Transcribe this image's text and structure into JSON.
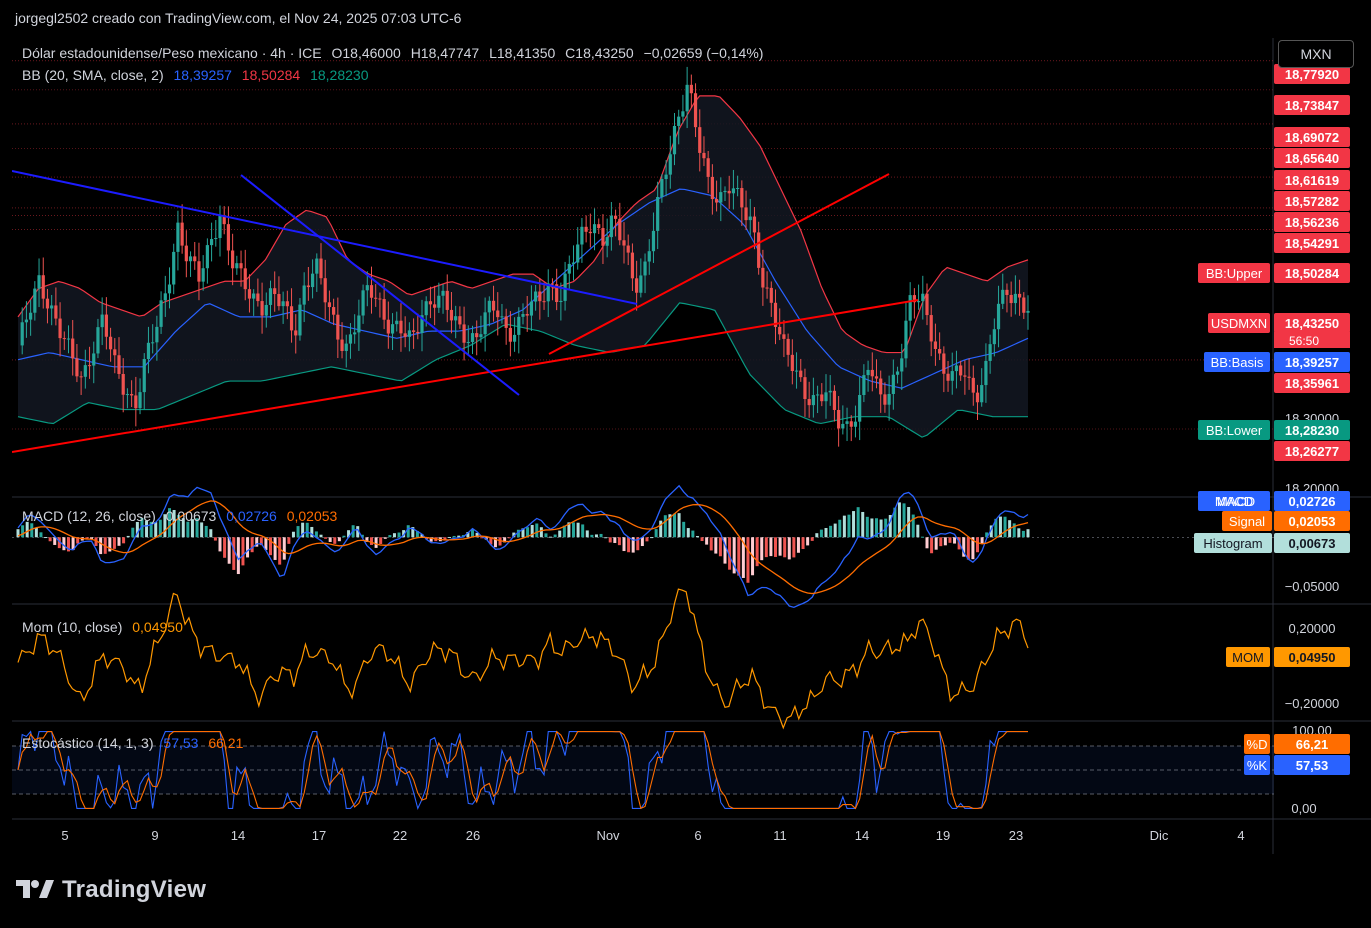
{
  "header": {
    "author_line": "jorgegl2502 creado con TradingView.com, el Nov 24, 2025 07:03 UTC-6"
  },
  "currency_button": "MXN",
  "main_legend": {
    "symbol": "Dólar estadounidense/Peso mexicano · 4h · ICE",
    "open": "O18,46000",
    "high": "H18,47747",
    "low": "L18,41350",
    "close": "C18,43250",
    "change": "−0,02659 (−0,14%)"
  },
  "bb_legend": {
    "label": "BB (20, SMA, close, 2)",
    "basis": "18,39257",
    "upper": "18,50284",
    "lower": "18,28230"
  },
  "macd_legend": {
    "label": "MACD (12, 26, close)",
    "hist": "0,00673",
    "macd": "0,02726",
    "signal": "0,02053"
  },
  "mom_legend": {
    "label": "Mom (10, close)",
    "value": "0,04950"
  },
  "stoch_legend": {
    "label": "Estocástico (14, 1, 3)",
    "k": "57,53",
    "d": "66,21"
  },
  "price_axis": {
    "red_labels": [
      "18,77920",
      "18,73847",
      "18,69072",
      "18,65640",
      "18,61619",
      "18,57282",
      "18,56236",
      "18,54291",
      "18,35961",
      "18,26277"
    ],
    "plain_labels": [
      "18,30000",
      "18,20000"
    ],
    "bb_upper": {
      "tag": "BB:Upper",
      "value": "18,50284"
    },
    "last_price": {
      "tag": "USDMXN",
      "value": "18,43250",
      "countdown": "56:50"
    },
    "bb_basis": {
      "tag": "BB:Basis",
      "value": "18,39257"
    },
    "bb_lower": {
      "tag": "BB:Lower",
      "value": "18,28230"
    }
  },
  "macd_axis": {
    "macd_tag": {
      "tag": "MACD",
      "value": "0,02726"
    },
    "signal_tag": {
      "tag": "Signal",
      "value": "0,02053"
    },
    "hist_tag": {
      "tag": "Histogram",
      "value": "0,00673"
    },
    "tick": "−0,05000"
  },
  "mom_axis": {
    "ticks": [
      "0,20000",
      "−0,20000"
    ],
    "tag": {
      "tag": "MOM",
      "value": "0,04950"
    }
  },
  "stoch_axis": {
    "ticks": [
      "100,00",
      "0,00"
    ],
    "d_tag": {
      "tag": "%D",
      "value": "66,21"
    },
    "k_tag": {
      "tag": "%K",
      "value": "57,53"
    }
  },
  "time_axis": [
    "5",
    "9",
    "14",
    "17",
    "22",
    "26",
    "Nov",
    "6",
    "11",
    "14",
    "19",
    "23",
    "Dic",
    "4"
  ],
  "brand": "TradingView",
  "colors": {
    "up": "#26a69a",
    "down": "#ef5350",
    "bb_upper": "#f23645",
    "bb_basis": "#2962ff",
    "bb_lower": "#089981",
    "macd": "#2962ff",
    "signal": "#ff6d00",
    "mom": "#ff9800",
    "trend_red": "#ff0000",
    "trend_blue": "#1c1cff"
  },
  "chart_data": {
    "type": "candlestick",
    "title": "Dólar estadounidense/Peso mexicano · 4h · ICE",
    "symbol": "USDMXN",
    "timeframe": "4h",
    "y_axis_price": [
      18.18,
      18.8
    ],
    "x_ticks": [
      "5",
      "9",
      "14",
      "17",
      "22",
      "26",
      "Nov",
      "6",
      "11",
      "14",
      "19",
      "23",
      "Dic",
      "4"
    ],
    "close_path": [
      18.38,
      18.42,
      18.47,
      18.44,
      18.4,
      18.36,
      18.33,
      18.38,
      18.42,
      18.35,
      18.32,
      18.3,
      18.36,
      18.4,
      18.46,
      18.55,
      18.5,
      18.47,
      18.52,
      18.57,
      18.5,
      18.47,
      18.45,
      18.44,
      18.45,
      18.43,
      18.4,
      18.47,
      18.49,
      18.44,
      18.4,
      18.38,
      18.42,
      18.46,
      18.44,
      18.41,
      18.4,
      18.38,
      18.43,
      18.45,
      18.44,
      18.41,
      18.4,
      18.39,
      18.42,
      18.43,
      18.4,
      18.41,
      18.43,
      18.44,
      18.47,
      18.45,
      18.49,
      18.53,
      18.56,
      18.53,
      18.55,
      18.52,
      18.47,
      18.49,
      18.56,
      18.63,
      18.7,
      18.75,
      18.66,
      18.6,
      18.59,
      18.61,
      18.57,
      18.55,
      18.48,
      18.43,
      18.37,
      18.35,
      18.32,
      18.3,
      18.31,
      18.28,
      18.27,
      18.29,
      18.35,
      18.31,
      18.32,
      18.36,
      18.44,
      18.45,
      18.4,
      18.34,
      18.33,
      18.35,
      18.31,
      18.34,
      18.42,
      18.46,
      18.45,
      18.43
    ],
    "bb_upper_path": [
      18.42,
      18.46,
      18.47,
      18.46,
      18.44,
      18.43,
      18.42,
      18.44,
      18.45,
      18.46,
      18.47,
      18.47,
      18.5,
      18.55,
      18.57,
      18.56,
      18.5,
      18.48,
      18.47,
      18.45,
      18.46,
      18.47,
      18.46,
      18.47,
      18.48,
      18.48,
      18.46,
      18.47,
      18.5,
      18.55,
      18.58,
      18.6,
      18.68,
      18.73,
      18.73,
      18.7,
      18.66,
      18.6,
      18.54,
      18.46,
      18.4,
      18.38,
      18.37,
      18.37,
      18.45,
      18.49,
      18.48,
      18.47,
      18.49,
      18.5
    ],
    "bb_basis_path": [
      18.36,
      18.37,
      18.36,
      18.35,
      18.35,
      18.4,
      18.44,
      18.42,
      18.42,
      18.43,
      18.41,
      18.4,
      18.39,
      18.4,
      18.4,
      18.41,
      18.43,
      18.47,
      18.51,
      18.55,
      18.58,
      18.6,
      18.59,
      18.55,
      18.47,
      18.4,
      18.35,
      18.33,
      18.32,
      18.34,
      18.36,
      18.37,
      18.39
    ],
    "bb_lower_path": [
      18.28,
      18.27,
      18.3,
      18.29,
      18.29,
      18.31,
      18.33,
      18.33,
      18.34,
      18.35,
      18.34,
      18.33,
      18.36,
      18.38,
      18.41,
      18.4,
      18.38,
      18.37,
      18.38,
      18.44,
      18.43,
      18.34,
      18.29,
      18.27,
      18.28,
      18.28,
      18.25,
      18.29,
      18.28,
      18.28
    ],
    "macd_y": [
      -0.07,
      0.04
    ],
    "mom_y": [
      -0.26,
      0.26
    ],
    "stoch_y": [
      0,
      100
    ]
  }
}
